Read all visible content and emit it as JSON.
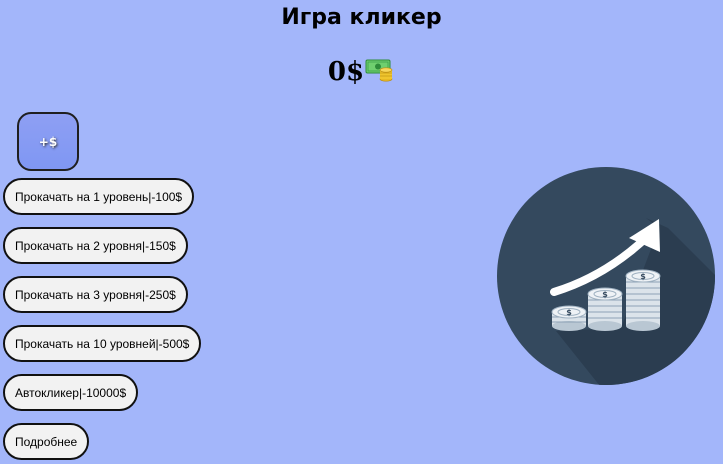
{
  "header": {
    "title": "Игра кликер"
  },
  "balance": {
    "amount": "0$",
    "icon": "money-banknote-coins-icon"
  },
  "click_button": {
    "label": "+$"
  },
  "upgrades": [
    {
      "label": "Прокачать на 1 уровень|-100$"
    },
    {
      "label": "Прокачать на 2 уровня|-150$"
    },
    {
      "label": "Прокачать на 3 уровня|-250$"
    },
    {
      "label": "Прокачать на 10 уровней|-500$"
    },
    {
      "label": "Автокликер|-10000$"
    },
    {
      "label": "Подробнее"
    }
  ],
  "illustration": {
    "icon": "growth-coins-chart-icon"
  },
  "colors": {
    "background": "#a3b6fa",
    "circle": "#34495e",
    "button_fill": "#f2f2f2"
  }
}
